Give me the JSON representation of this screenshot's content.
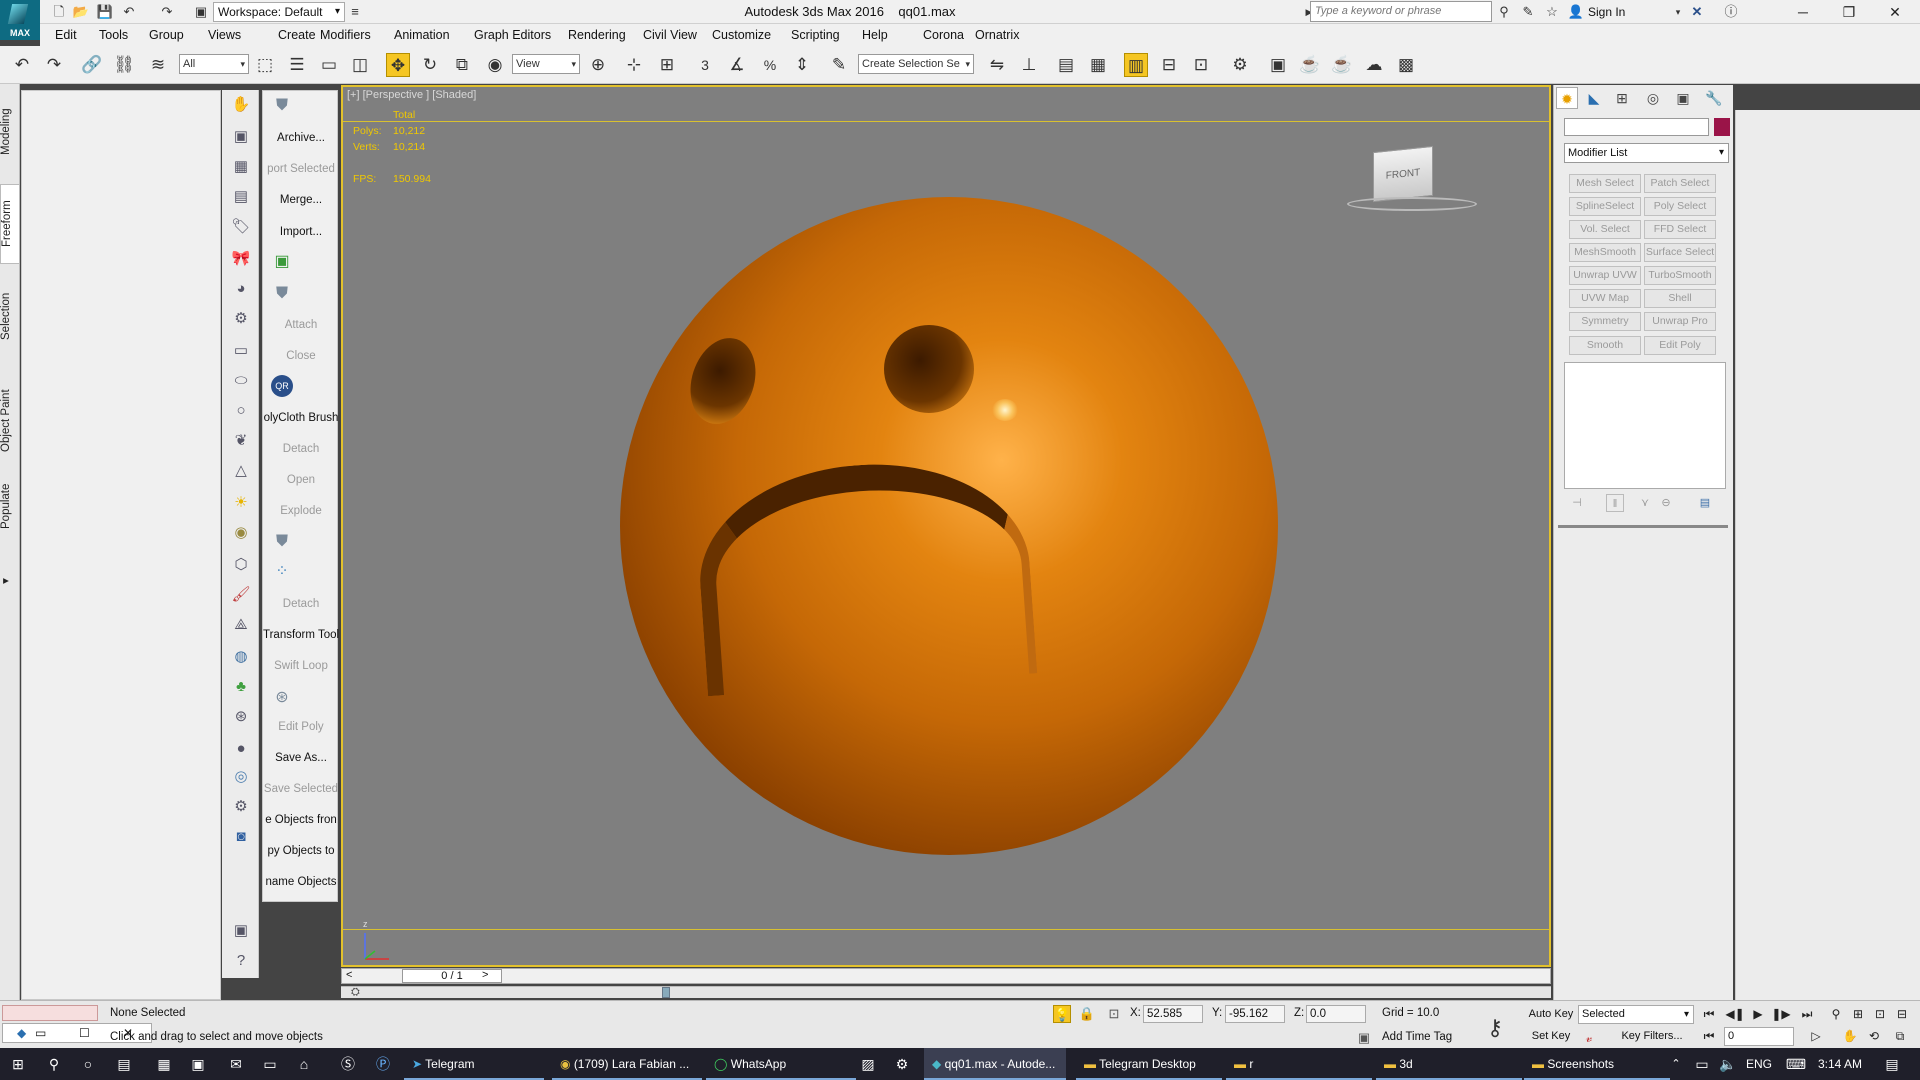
{
  "titlebar": {
    "app_title": "Autodesk 3ds Max 2016",
    "file_name": "qq01.max",
    "workspace_label": "Workspace: Default",
    "search_placeholder": "Type a keyword or phrase",
    "sign_in": "Sign In",
    "logo_text": "MAX"
  },
  "menu": {
    "items": [
      "Edit",
      "Tools",
      "Group",
      "Views",
      "Create",
      "Modifiers",
      "Animation",
      "Graph Editors",
      "Rendering",
      "Civil View",
      "Customize",
      "Scripting",
      "Help",
      "Corona",
      "Ornatrix"
    ]
  },
  "toolbar": {
    "filter_value": "All",
    "refcoord_value": "View",
    "selection_set_placeholder": "Create Selection Se",
    "snap_label": "3",
    "angle_label": "%"
  },
  "left_tabs": [
    "Modeling",
    "Freeform",
    "Selection",
    "Object Paint",
    "Populate"
  ],
  "label_panel": {
    "items": [
      {
        "text": "Archive...",
        "dim": false
      },
      {
        "text": "port Selected",
        "dim": true
      },
      {
        "text": "Merge...",
        "dim": false
      },
      {
        "text": "Import...",
        "dim": false
      },
      {
        "text": "Attach",
        "dim": true
      },
      {
        "text": "Close",
        "dim": true
      },
      {
        "text": "olyCloth Brush",
        "dim": false
      },
      {
        "text": "Detach",
        "dim": true
      },
      {
        "text": "Open",
        "dim": true
      },
      {
        "text": "Explode",
        "dim": true
      },
      {
        "text": "Detach",
        "dim": true
      },
      {
        "text": "Transform Tool",
        "dim": false
      },
      {
        "text": "Swift Loop",
        "dim": true
      },
      {
        "text": "Edit Poly",
        "dim": true
      },
      {
        "text": "Save As...",
        "dim": false
      },
      {
        "text": "Save Selected",
        "dim": true
      },
      {
        "text": "e Objects fron",
        "dim": false
      },
      {
        "text": "py Objects to",
        "dim": false
      },
      {
        "text": "name Objects",
        "dim": false
      }
    ],
    "qr_label": "QR"
  },
  "viewport": {
    "label": "[+] [Perspective ] [Shaded]",
    "stats_total": "Total",
    "polys_label": "Polys:",
    "polys_value": "10,212",
    "verts_label": "Verts:",
    "verts_value": "10,214",
    "fps_label": "FPS:",
    "fps_value": "150.994",
    "viewcube_text": "FRONT",
    "axis_z": "z"
  },
  "timeline": {
    "frame_label": "0 / 1",
    "prev": "<",
    "next": ">"
  },
  "command_panel": {
    "modifier_list": "Modifier List",
    "modifier_buttons": [
      "Mesh Select",
      "Patch Select",
      "SplineSelect",
      "Poly Select",
      "Vol. Select",
      "FFD Select",
      "MeshSmooth",
      "Surface Select",
      "Unwrap UVW",
      "TurboSmooth",
      "UVW Map",
      "Shell",
      "Symmetry",
      "Unwrap Pro",
      "Smooth",
      "Edit Poly"
    ],
    "object_color": "#9a1448"
  },
  "status": {
    "selection": "None Selected",
    "prompt": "Click and drag to select and move objects",
    "x_label": "X:",
    "x_value": "52.585",
    "y_label": "Y:",
    "y_value": "-95.162",
    "z_label": "Z:",
    "z_value": "0.0",
    "grid": "Grid = 10.0",
    "add_time_tag": "Add Time Tag",
    "auto_key": "Auto Key",
    "set_key": "Set Key",
    "selected_value": "Selected",
    "key_filters": "Key Filters...",
    "current_frame": "0"
  },
  "taskbar": {
    "apps": [
      {
        "label": "Telegram",
        "icon": "telegram-icon"
      },
      {
        "label": "(1709) Lara Fabian ...",
        "icon": "chrome-icon"
      },
      {
        "label": "WhatsApp",
        "icon": "whatsapp-icon"
      },
      {
        "label": "qq01.max - Autode...",
        "icon": "3dsmax-icon"
      },
      {
        "label": "Telegram Desktop",
        "icon": "folder-icon"
      },
      {
        "label": "r",
        "icon": "folder-icon"
      },
      {
        "label": "3d",
        "icon": "folder-icon"
      },
      {
        "label": "Screenshots",
        "icon": "folder-icon"
      }
    ],
    "language": "ENG",
    "time": "3:14 AM"
  },
  "colors": {
    "viewport_border": "#e2c12c",
    "sphere": "#d4760a",
    "stats_text": "#f0c800",
    "taskbar": "#1f1f2a"
  }
}
